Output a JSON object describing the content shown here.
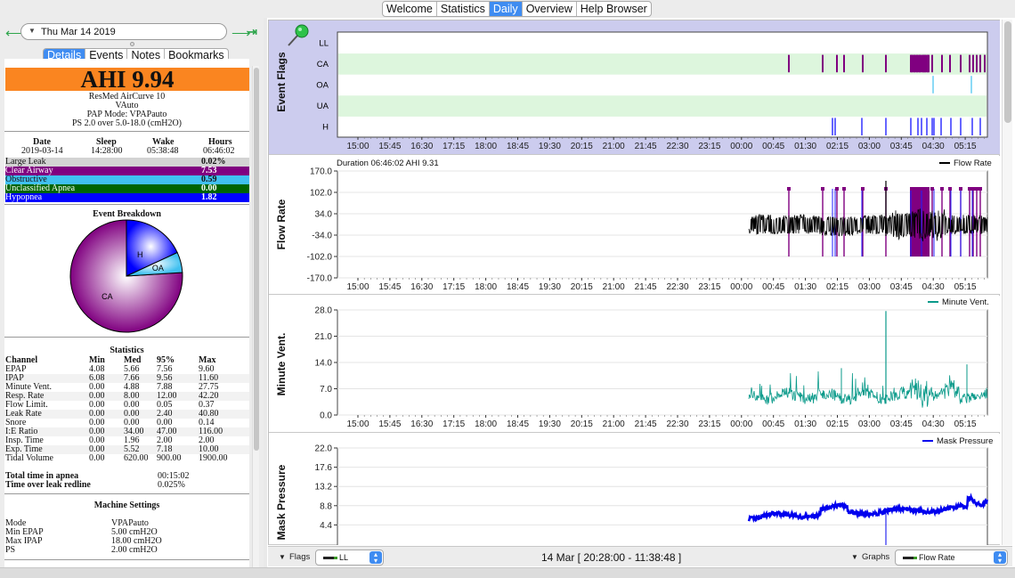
{
  "top_tabs": [
    {
      "label": "Welcome"
    },
    {
      "label": "Statistics"
    },
    {
      "label": "Daily",
      "active": true
    },
    {
      "label": "Overview"
    },
    {
      "label": "Help Browser"
    }
  ],
  "nav": {
    "date": "Thu Mar 14 2019",
    "back_icon": "arrow-left-icon",
    "forward_icon": "arrow-right-icon",
    "last_icon": "jump-to-last-icon"
  },
  "sub_tabs": [
    {
      "label": "Details",
      "active": true
    },
    {
      "label": "Events"
    },
    {
      "label": "Notes"
    },
    {
      "label": "Bookmarks"
    }
  ],
  "details": {
    "ahi": "AHI 9.94",
    "device": "ResMed AirCurve 10",
    "variant": "VAuto",
    "pap_mode": "PAP Mode: VPAPauto",
    "pressure": "PS 2.0 over 5.0-18.0 (cmH2O)",
    "summary_headers": [
      "Date",
      "Sleep",
      "Wake",
      "Hours"
    ],
    "summary_values": [
      "2019-03-14",
      "14:28:00",
      "05:38:48",
      "06:46:02"
    ],
    "events": [
      {
        "label": "Large Leak",
        "value": "0.02%",
        "bg": "#d3d3d3",
        "fg": "#111111"
      },
      {
        "label": "Clear Airway",
        "value": "7.53",
        "bg": "#800080",
        "fg": "#ffffff"
      },
      {
        "label": "Obstructive",
        "value": "0.59",
        "bg": "#40c0f0",
        "fg": "#111111"
      },
      {
        "label": "Unclassified Apnea",
        "value": "0.00",
        "bg": "#006400",
        "fg": "#ffffff"
      },
      {
        "label": "Hypopnea",
        "value": "1.82",
        "bg": "#0000ff",
        "fg": "#ffffff"
      }
    ],
    "event_breakdown_title": "Event Breakdown",
    "pie": [
      {
        "label": "CA",
        "value": 76.0,
        "color": "#800080"
      },
      {
        "label": "H",
        "value": 18.1,
        "color": "#0000ff"
      },
      {
        "label": "OA",
        "value": 5.9,
        "color": "#40c0f0"
      }
    ],
    "statistics_title": "Statistics",
    "stats_headers": [
      "Channel",
      "Min",
      "Med",
      "95%",
      "Max"
    ],
    "stats_rows": [
      [
        "EPAP",
        "4.08",
        "5.66",
        "7.56",
        "9.60"
      ],
      [
        "IPAP",
        "6.08",
        "7.66",
        "9.56",
        "11.60"
      ],
      [
        "Minute Vent.",
        "0.00",
        "4.88",
        "7.88",
        "27.75"
      ],
      [
        "Resp. Rate",
        "0.00",
        "8.00",
        "12.00",
        "42.20"
      ],
      [
        "Flow Limit.",
        "0.00",
        "0.00",
        "0.05",
        "0.37"
      ],
      [
        "Leak Rate",
        "0.00",
        "0.00",
        "2.40",
        "40.80"
      ],
      [
        "Snore",
        "0.00",
        "0.00",
        "0.00",
        "0.14"
      ],
      [
        "I:E Ratio",
        "0.00",
        "34.00",
        "47.00",
        "116.00"
      ],
      [
        "Insp. Time",
        "0.00",
        "1.96",
        "2.00",
        "2.00"
      ],
      [
        "Exp. Time",
        "0.00",
        "5.52",
        "7.18",
        "10.00"
      ],
      [
        "Tidal Volume",
        "0.00",
        "620.00",
        "900.00",
        "1900.00"
      ]
    ],
    "totals": [
      {
        "label": "Total time in apnea",
        "value": "00:15:02"
      },
      {
        "label": "Time over leak redline",
        "value": "0.025%"
      }
    ],
    "machine_settings_title": "Machine Settings",
    "machine_settings": [
      {
        "label": "Mode",
        "value": "VPAPauto"
      },
      {
        "label": "Min EPAP",
        "value": "5.00 cmH2O"
      },
      {
        "label": "Max IPAP",
        "value": "18.00 cmH2O"
      },
      {
        "label": "PS",
        "value": "2.00 cmH2O"
      }
    ]
  },
  "time_ticks": [
    "15:00",
    "15:45",
    "16:30",
    "17:15",
    "18:00",
    "18:45",
    "19:30",
    "20:15",
    "21:00",
    "21:45",
    "22:30",
    "23:15",
    "00:00",
    "00:45",
    "01:30",
    "02:15",
    "03:00",
    "03:45",
    "04:30",
    "05:15"
  ],
  "graphs": {
    "event_flags": {
      "title": "Event Flags",
      "rows": [
        "LL",
        "CA",
        "OA",
        "UA",
        "H"
      ],
      "pin_icon": "pushpin-icon"
    },
    "flow_rate": {
      "title": "Flow Rate",
      "header": "Duration 06:46:02 AHI 9.31",
      "legend": "Flow Rate",
      "yticks": [
        "170.0",
        "102.0",
        "34.0",
        "-34.0",
        "-102.0",
        "-170.0"
      ],
      "color": "#000000"
    },
    "minute_vent": {
      "title": "Minute Vent.",
      "legend": "Minute Vent.",
      "yticks": [
        "28.0",
        "21.0",
        "14.0",
        "7.0",
        "0.0"
      ],
      "color": "#0a9a8a"
    },
    "mask_pressure": {
      "title": "Mask Pressure",
      "legend": "Mask Pressure",
      "yticks": [
        "22.0",
        "17.6",
        "13.2",
        "8.8",
        "4.4"
      ],
      "color": "#0000ee"
    }
  },
  "bottom_bar": {
    "flags_label": "Flags",
    "flags_value": "LL",
    "date_range": "14 Mar [ 20:28:00 - 11:38:48 ]",
    "graphs_label": "Graphs",
    "graphs_value": "Flow Rate"
  }
}
